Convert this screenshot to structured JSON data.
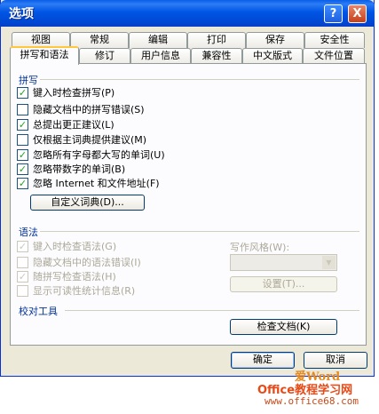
{
  "window": {
    "title": "选项",
    "help_label": "?",
    "close_label": "X"
  },
  "tabs_row1": [
    "视图",
    "常规",
    "编辑",
    "打印",
    "保存",
    "安全性"
  ],
  "tabs_row2": [
    "拼写和语法",
    "修订",
    "用户信息",
    "兼容性",
    "中文版式",
    "文件位置"
  ],
  "active_tab": "拼写和语法",
  "spelling": {
    "section_title": "拼写",
    "options": [
      {
        "label": "键入时检查拼写(P)",
        "checked": true
      },
      {
        "label": "隐藏文档中的拼写错误(S)",
        "checked": false
      },
      {
        "label": "总提出更正建议(L)",
        "checked": true
      },
      {
        "label": "仅根据主词典提供建议(M)",
        "checked": false
      },
      {
        "label": "忽略所有字母都大写的单词(U)",
        "checked": true
      },
      {
        "label": "忽略带数字的单词(B)",
        "checked": true
      },
      {
        "label": "忽略 Internet 和文件地址(F)",
        "checked": true
      }
    ],
    "custom_dict_button": "自定义词典(D)..."
  },
  "grammar": {
    "section_title": "语法",
    "options": [
      {
        "label": "键入时检查语法(G)",
        "checked": true
      },
      {
        "label": "隐藏文档中的语法错误(I)",
        "checked": false
      },
      {
        "label": "随拼写检查语法(H)",
        "checked": true
      },
      {
        "label": "显示可读性统计信息(R)",
        "checked": false
      }
    ],
    "style_label": "写作风格(W):",
    "style_value": "",
    "settings_button": "设置(T)..."
  },
  "proofing": {
    "section_title": "校对工具",
    "check_doc_button": "检查文档(K)"
  },
  "footer": {
    "ok_label": "确定",
    "cancel_label": "取消"
  },
  "watermark": {
    "brand_top": "爱Word",
    "brand_main": "Office教程学习网",
    "url": "www.office68.com"
  }
}
